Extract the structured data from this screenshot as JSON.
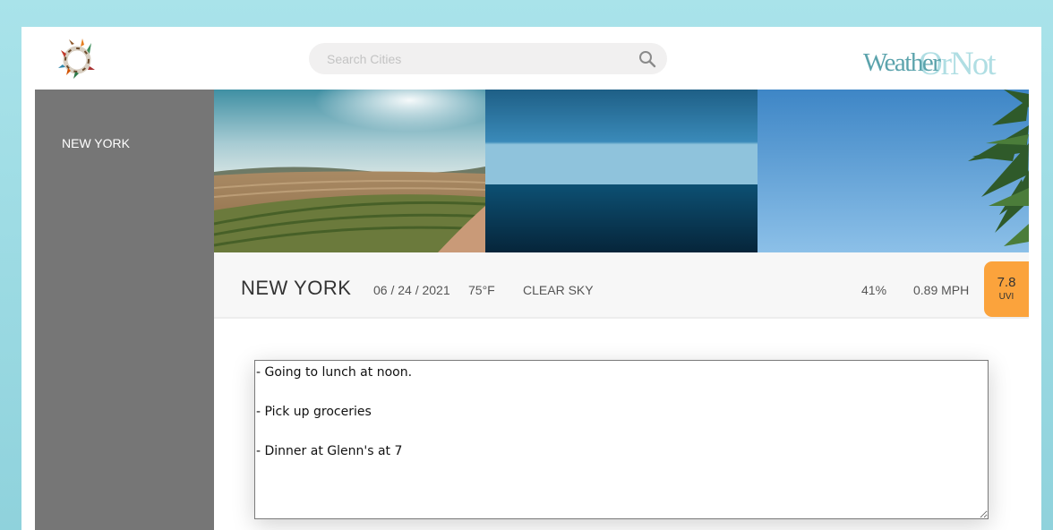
{
  "header": {
    "brand_part1": "Weather",
    "brand_part2": "OrNot",
    "search": {
      "placeholder": "Search Cities",
      "value": ""
    },
    "logo_icon": "wreath-circle-logo",
    "search_icon": "magnifier-icon"
  },
  "sidebar": {
    "items": [
      {
        "label": "NEW YORK"
      }
    ]
  },
  "photos": [
    {
      "subject": "farmland-hills"
    },
    {
      "subject": "ocean-horizon"
    },
    {
      "subject": "palm-tree-sky"
    }
  ],
  "weather": {
    "city": "NEW YORK",
    "date": "06 / 24 / 2021",
    "temp": "75°F",
    "description": "CLEAR SKY",
    "humidity": "41%",
    "wind": "0.89 MPH",
    "uvi_value": "7.8",
    "uvi_label": "UVI"
  },
  "notes": {
    "value": "- Going to lunch at noon.\n\n- Pick up groceries\n\n- Dinner at Glenn's at 7"
  },
  "colors": {
    "background": "#a9e3ea",
    "sidebar": "#767676",
    "uvi_badge": "#fba33c",
    "brand_dark": "#5ba3ac",
    "brand_light": "#a8dbe1"
  }
}
